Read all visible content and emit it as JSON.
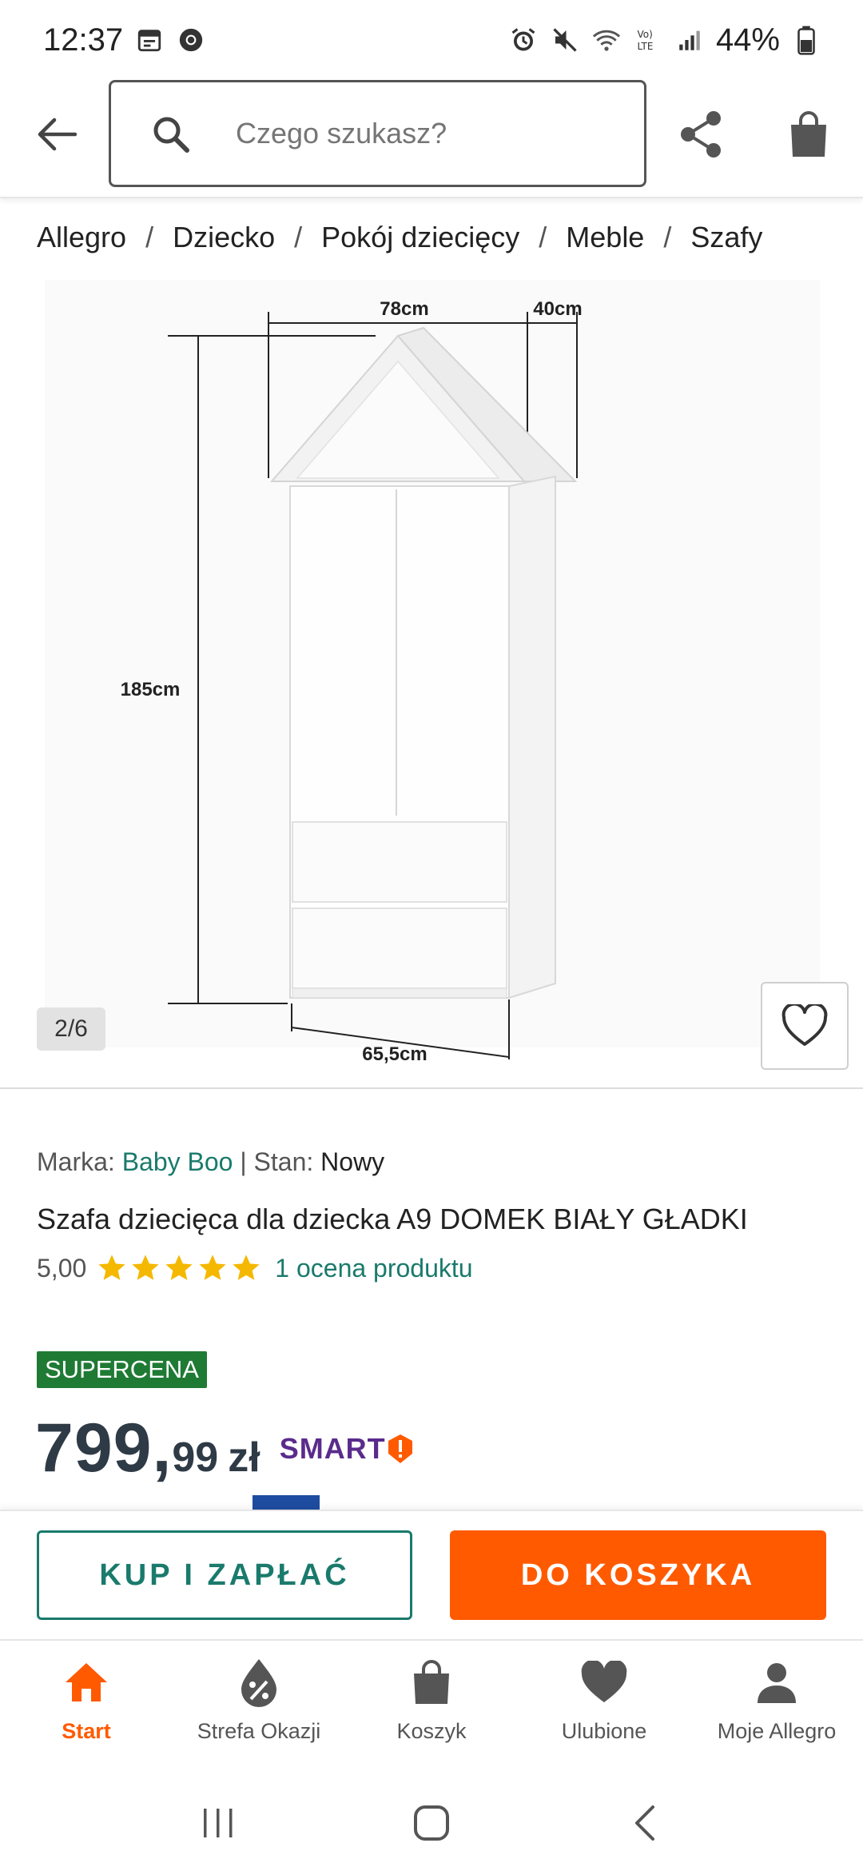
{
  "status_bar": {
    "time": "12:37",
    "battery": "44%"
  },
  "header": {
    "search_placeholder": "Czego szukasz?"
  },
  "breadcrumb": [
    "Allegro",
    "Dziecko",
    "Pokój dziecięcy",
    "Meble",
    "Szafy"
  ],
  "gallery": {
    "counter": "2/6",
    "dimensions": {
      "width_top": "78cm",
      "depth": "40cm",
      "height": "185cm",
      "width_bottom": "65,5cm"
    }
  },
  "product": {
    "brand_label": "Marka:",
    "brand": "Baby Boo",
    "separator": "|",
    "condition_label": "Stan:",
    "condition": "Nowy",
    "title": "Szafa dziecięca dla dziecka A9 DOMEK BIAŁY GŁADKI",
    "rating_value": "5,00",
    "rating_stars": 5,
    "rating_link": "1 ocena produktu",
    "badge": "SUPERCENA",
    "price_main": "799,",
    "price_cents": "99",
    "price_currency": "zł",
    "smart_label": "SMART"
  },
  "actions": {
    "buy_label": "KUP I ZAPŁAĆ",
    "cart_label": "DO KOSZYKA"
  },
  "bottom_nav": [
    {
      "label": "Start",
      "icon": "home-icon",
      "active": true
    },
    {
      "label": "Strefa Okazji",
      "icon": "discount-icon",
      "active": false
    },
    {
      "label": "Koszyk",
      "icon": "bag-icon",
      "active": false
    },
    {
      "label": "Ulubione",
      "icon": "heart-icon",
      "active": false
    },
    {
      "label": "Moje Allegro",
      "icon": "person-icon",
      "active": false
    }
  ],
  "colors": {
    "accent_orange": "#ff5a00",
    "accent_teal": "#1a7a6c",
    "supercena_green": "#1f7a34",
    "star_yellow": "#f5b800",
    "smart_purple": "#5a2b8c"
  }
}
